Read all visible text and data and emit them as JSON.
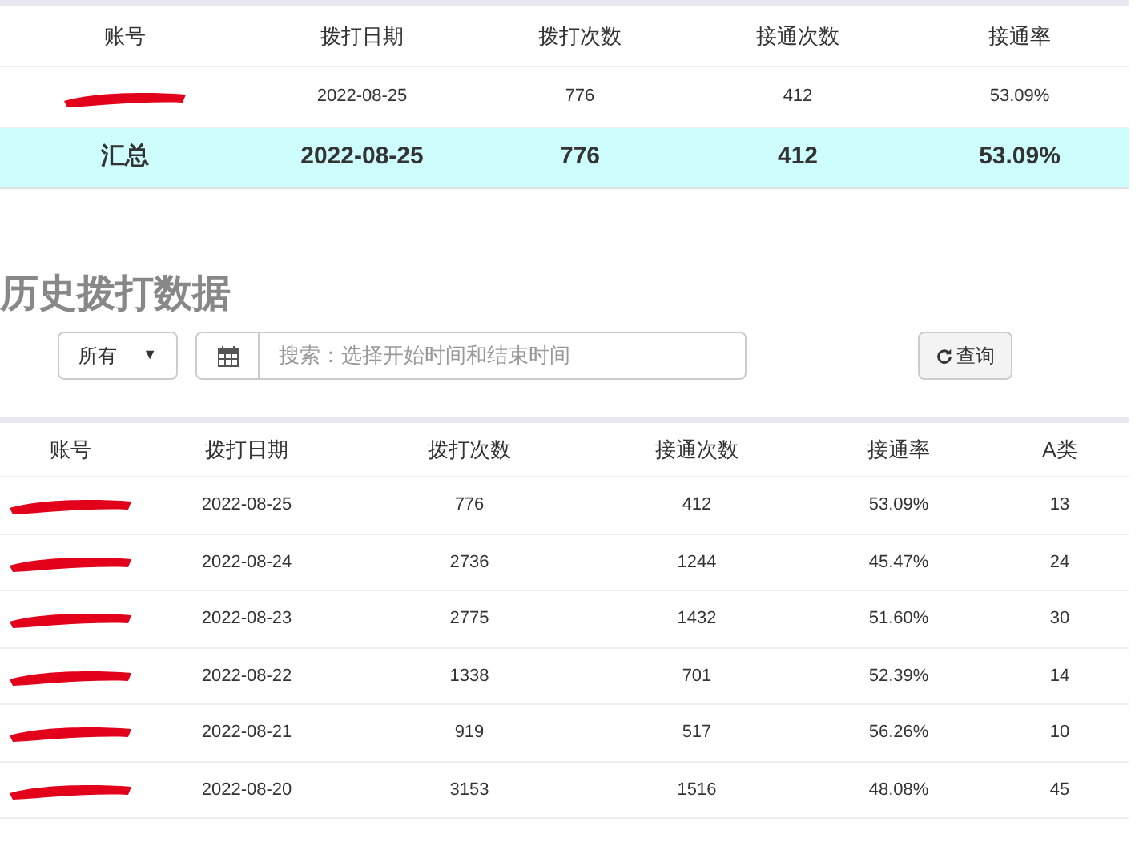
{
  "summary_table": {
    "columns": [
      "账号",
      "拨打日期",
      "拨打次数",
      "接通次数",
      "接通率"
    ],
    "rows": [
      [
        "",
        "2022-08-25",
        "776",
        "412",
        "53.09%"
      ]
    ],
    "total": {
      "label": "汇总",
      "cells": [
        "2022-08-25",
        "776",
        "412",
        "53.09%"
      ]
    }
  },
  "history": {
    "title": "历史拨打数据",
    "filter": {
      "value": "所有",
      "caret": "▼"
    },
    "search": {
      "placeholder": "搜索：选择开始时间和结束时间"
    },
    "query_button": "查询",
    "columns": [
      "账号",
      "拨打日期",
      "拨打次数",
      "接通次数",
      "接通率",
      "A类"
    ],
    "rows": [
      [
        "",
        "2022-08-25",
        "776",
        "412",
        "53.09%",
        "13"
      ],
      [
        "",
        "2022-08-24",
        "2736",
        "1244",
        "45.47%",
        "24"
      ],
      [
        "",
        "2022-08-23",
        "2775",
        "1432",
        "51.60%",
        "30"
      ],
      [
        "",
        "2022-08-22",
        "1338",
        "701",
        "52.39%",
        "14"
      ],
      [
        "",
        "2022-08-21",
        "919",
        "517",
        "56.26%",
        "10"
      ],
      [
        "",
        "2022-08-20",
        "3153",
        "1516",
        "48.08%",
        "45"
      ]
    ]
  }
}
